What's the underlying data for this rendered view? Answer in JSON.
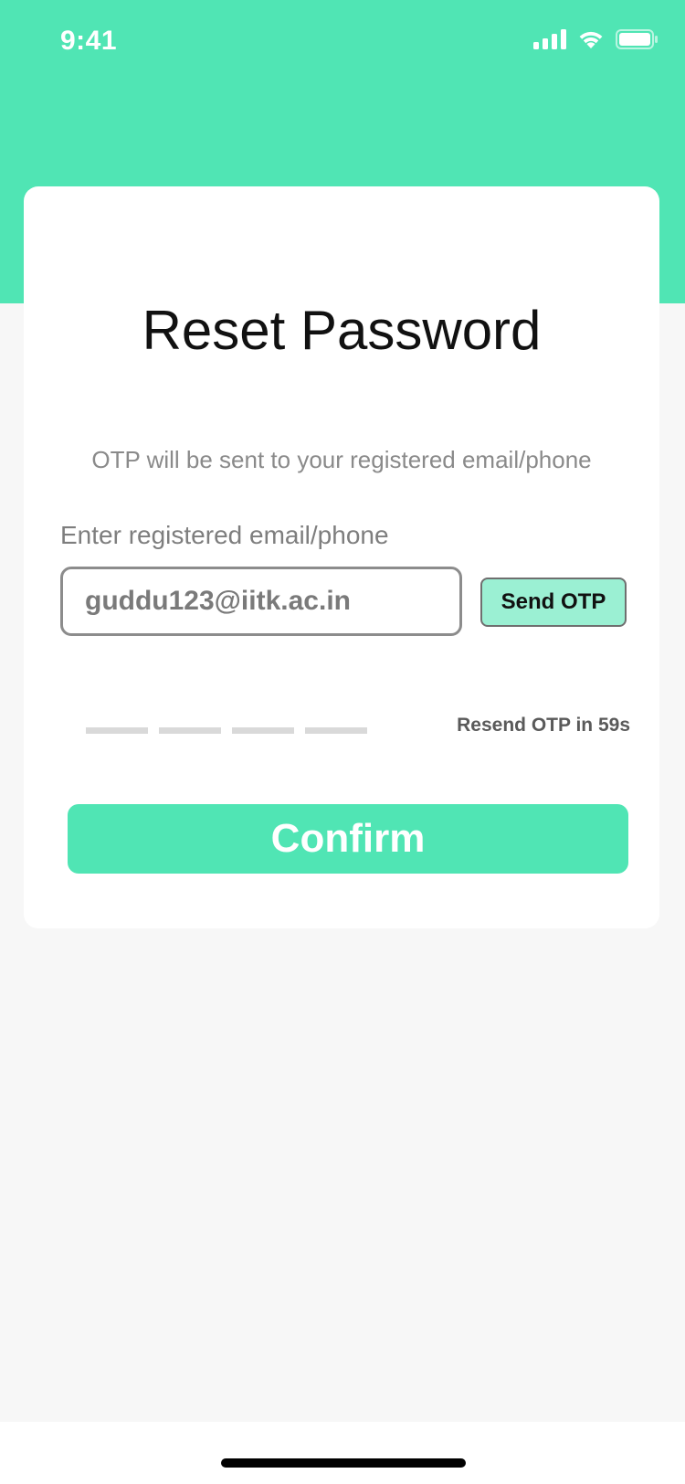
{
  "status_bar": {
    "time": "9:41",
    "icons": [
      "cellular-signal-icon",
      "wifi-icon",
      "battery-icon"
    ]
  },
  "colors": {
    "accent": "#50e5b4",
    "send_otp_bg": "#9bf0d3",
    "background": "#f7f7f7",
    "card": "#ffffff"
  },
  "card": {
    "title": "Reset Password",
    "info_text": "OTP will be sent to your registered email/phone",
    "email_label": "Enter registered email/phone",
    "email_value": "guddu123@iitk.ac.in",
    "send_otp_label": "Send OTP",
    "otp_slot_count": 4,
    "resend_text": "Resend OTP in 59s",
    "confirm_label": "Confirm"
  }
}
